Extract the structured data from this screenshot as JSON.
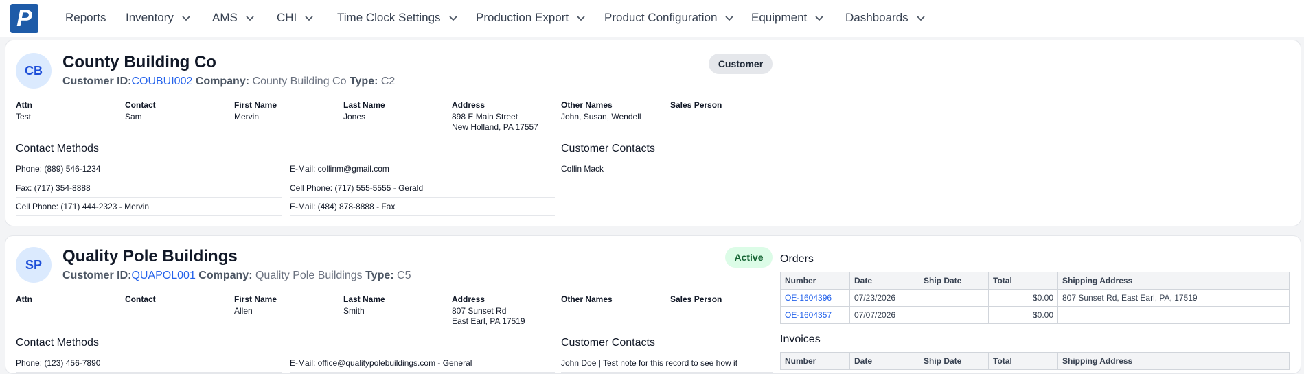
{
  "nav": {
    "logo": "P",
    "items": [
      {
        "label": "Reports",
        "dropdown": false
      },
      {
        "label": "Inventory",
        "dropdown": true
      },
      {
        "label": "AMS",
        "dropdown": true
      },
      {
        "label": "CHI",
        "dropdown": true
      },
      {
        "label": "Time Clock Settings",
        "dropdown": true
      },
      {
        "label": "Production Export",
        "dropdown": true
      },
      {
        "label": "Product Configuration",
        "dropdown": true
      },
      {
        "label": "Equipment",
        "dropdown": true
      },
      {
        "label": "Dashboards",
        "dropdown": true
      }
    ]
  },
  "labels": {
    "customer_id": "Customer ID:",
    "company": "Company:",
    "type": "Type:",
    "attn": "Attn",
    "contact": "Contact",
    "first_name": "First Name",
    "last_name": "Last Name",
    "address": "Address",
    "other_names": "Other Names",
    "sales_person": "Sales Person",
    "contact_methods": "Contact Methods",
    "customer_contacts": "Customer Contacts",
    "orders": "Orders",
    "invoices": "Invoices"
  },
  "colors": {
    "brand": "#1e5ba8",
    "link": "#2563eb",
    "active_badge_bg": "#dcfce7",
    "customer_badge_bg": "#e5e7eb"
  },
  "customers": [
    {
      "initials": "CB",
      "name": "County Building Co",
      "customer_id": "COUBUI002",
      "company": "County Building Co",
      "type": "C2",
      "badge": "Customer",
      "attn": "Test",
      "contact": "Sam",
      "first_name": "Mervin",
      "last_name": "Jones",
      "address_line1": "898 E Main Street",
      "address_line2": "New Holland, PA 17557",
      "other_names": "John, Susan, Wendell",
      "sales_person": "",
      "contact_methods_left": [
        "Phone: (889) 546-1234",
        "Fax: (717) 354-8888",
        "Cell Phone: (171) 444-2323 - Mervin"
      ],
      "contact_methods_right": [
        "E-Mail: collinm@gmail.com",
        "Cell Phone: (717) 555-5555 - Gerald",
        "E-Mail: (484) 878-8888 - Fax"
      ],
      "customer_contacts": [
        "Collin Mack"
      ]
    },
    {
      "initials": "SP",
      "name": "Quality Pole Buildings",
      "customer_id": "QUAPOL001",
      "company": "Quality Pole Buildings",
      "type": "C5",
      "badge": "Active",
      "attn": "",
      "contact": "",
      "first_name": "Allen",
      "last_name": "Smith",
      "address_line1": "807 Sunset Rd",
      "address_line2": "East Earl, PA 17519",
      "other_names": "",
      "sales_person": "",
      "contact_methods_left": [
        "Phone: (123) 456-7890"
      ],
      "contact_methods_right": [
        "E-Mail: office@qualitypolebuildings.com - General"
      ],
      "customer_contacts": [
        "John Doe | Test note for this record to see how it"
      ],
      "orders": {
        "columns": [
          "Number",
          "Date",
          "Ship Date",
          "Total",
          "Shipping Address"
        ],
        "rows": [
          [
            "OE-1604396",
            "07/23/2026",
            "",
            "$0.00",
            "807 Sunset Rd, East Earl, PA, 17519"
          ],
          [
            "OE-1604357",
            "07/07/2026",
            "",
            "$0.00",
            ""
          ]
        ]
      },
      "invoices": {
        "columns": [
          "Number",
          "Date",
          "Ship Date",
          "Total",
          "Shipping Address"
        ]
      }
    }
  ]
}
